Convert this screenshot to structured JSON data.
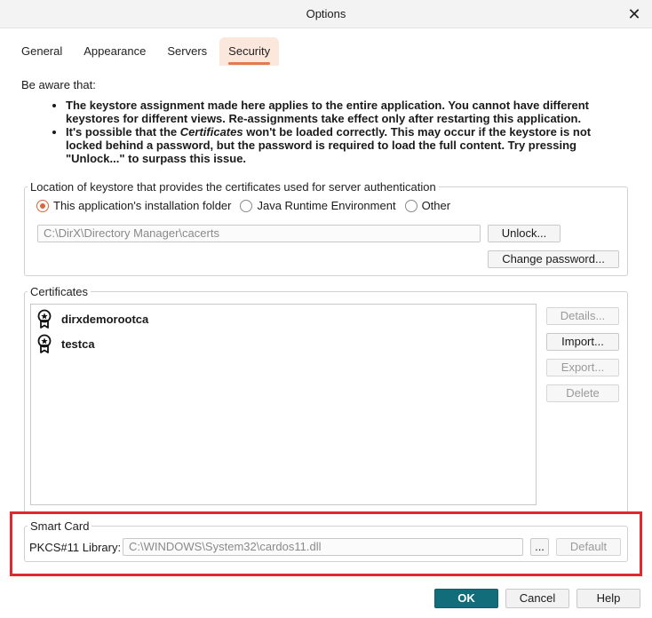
{
  "window": {
    "title": "Options",
    "close_glyph": "✕"
  },
  "tabs": [
    {
      "label": "General"
    },
    {
      "label": "Appearance"
    },
    {
      "label": "Servers"
    },
    {
      "label": "Security",
      "active": true
    }
  ],
  "notice": {
    "heading": "Be aware that:",
    "item1": "The keystore assignment made here applies to the entire application. You cannot have different keystores for different views. Re-assignments take effect only after restarting this application.",
    "item2_before": "It's possible that the ",
    "item2_emph": "Certificates",
    "item2_after": " won't be loaded correctly. This may occur if the keystore is not locked behind a password, but the password is required to load the full content. Try pressing \"Unlock...\" to surpass this issue."
  },
  "keystore": {
    "legend": "Location of keystore that provides the certificates used for server authentication",
    "options": [
      {
        "label": "This application's installation folder",
        "checked": true
      },
      {
        "label": "Java Runtime Environment",
        "checked": false
      },
      {
        "label": "Other",
        "checked": false
      }
    ],
    "path": "C:\\DirX\\Directory Manager\\cacerts",
    "unlock_label": "Unlock...",
    "change_password_label": "Change password..."
  },
  "certificates": {
    "legend": "Certificates",
    "items": [
      {
        "name": "dirxdemorootca"
      },
      {
        "name": "testca"
      }
    ],
    "details_label": "Details...",
    "import_label": "Import...",
    "export_label": "Export...",
    "delete_label": "Delete"
  },
  "smart_card": {
    "legend": "Smart Card",
    "library_label": "PKCS#11 Library:",
    "library_path": "C:\\WINDOWS\\System32\\cardos11.dll",
    "browse_label": "...",
    "default_label": "Default"
  },
  "footer": {
    "ok_label": "OK",
    "cancel_label": "Cancel",
    "help_label": "Help"
  },
  "colors": {
    "accent": "#e07a4f",
    "primary_button": "#106d79",
    "highlight": "#e0282e"
  }
}
